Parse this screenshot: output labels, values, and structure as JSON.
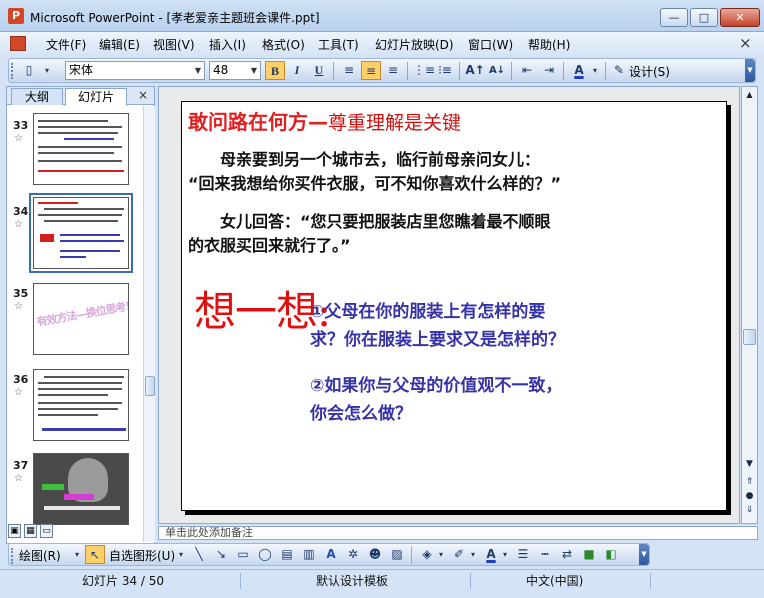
{
  "window": {
    "title": "Microsoft PowerPoint - [孝老爱亲主题班会课件.ppt]",
    "buttons": {
      "minimize": "—",
      "maximize": "□",
      "close": "✕"
    }
  },
  "menu": {
    "items": [
      "文件(F)",
      "编辑(E)",
      "视图(V)",
      "插入(I)",
      "格式(O)",
      "工具(T)",
      "幻灯片放映(D)",
      "窗口(W)",
      "帮助(H)"
    ],
    "close_doc": "×"
  },
  "toolbar": {
    "font": "宋体",
    "size": "48",
    "bold": "B",
    "italic": "I",
    "underline": "U",
    "design_label": "设计(S)"
  },
  "left_pane": {
    "tabs": {
      "outline": "大纲",
      "slides": "幻灯片"
    },
    "close": "×",
    "slides": [
      {
        "num": "33",
        "star": "☆",
        "label": ""
      },
      {
        "num": "34",
        "star": "☆",
        "label": ""
      },
      {
        "num": "35",
        "star": "☆",
        "label": "有效方法—换位思考!"
      },
      {
        "num": "36",
        "star": "☆",
        "label": ""
      },
      {
        "num": "37",
        "star": "☆",
        "label": ""
      }
    ]
  },
  "slide": {
    "title_main": "敢问路在何方—",
    "title_sub": "尊重理解是关键",
    "para1_line1": "　　母亲要到另一个城市去，临行前母亲问女儿：",
    "para1_line2": "“回来我想给你买件衣服，可不知你喜欢什么样的？”",
    "para2_line1": "　　女儿回答：“您只要把服装店里您瞧着最不顺眼",
    "para2_line2": "的衣服买回来就行了。”",
    "think": "想一想:",
    "q1_line1": "①父母在你的服装上有怎样的要",
    "q1_line2": "求？你在服装上要求又是怎样的？",
    "q2_line1": "②如果你与父母的价值观不一致，",
    "q2_line2": "你会怎么做？"
  },
  "notes": {
    "placeholder": "单击此处添加备注"
  },
  "drawing_toolbar": {
    "draw_label": "绘图(R)",
    "autoshape_label": "自选图形(U)"
  },
  "status": {
    "slide_position": "幻灯片 34 / 50",
    "template": "默认设计模板",
    "language": "中文(中国)"
  }
}
